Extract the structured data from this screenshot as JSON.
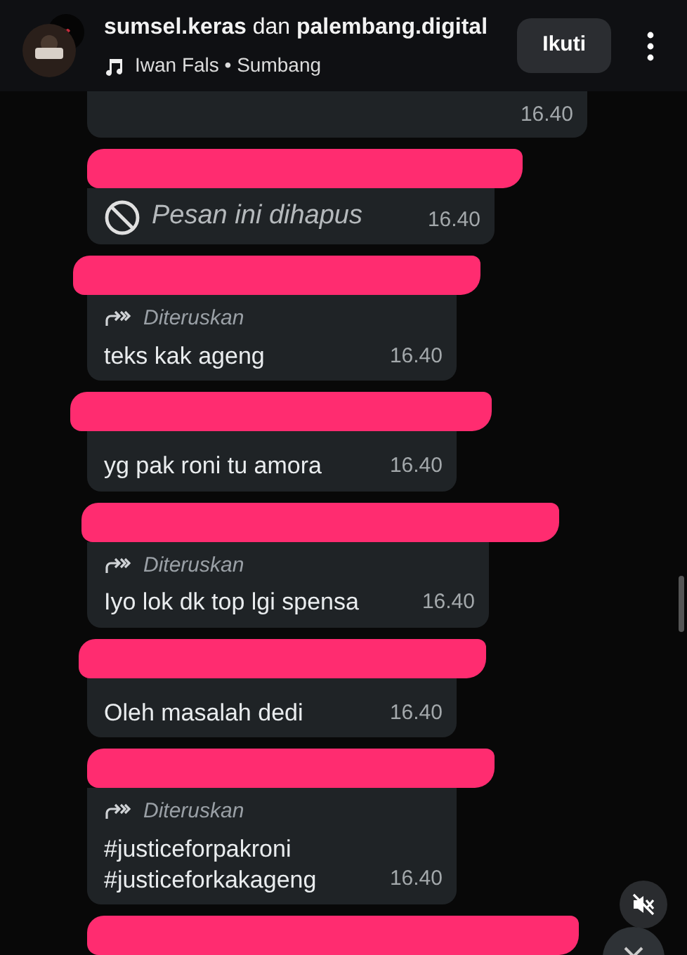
{
  "header": {
    "title": "**sumsel.keras** dan **palembang.digital**",
    "audio": "Iwan Fals • Sumbang",
    "follow_button": "Ikuti"
  },
  "messages": [
    {
      "kind": "partial",
      "time": "16.40"
    },
    {
      "kind": "deleted",
      "text": "Pesan ini dihapus",
      "time": "16.40"
    },
    {
      "kind": "forwarded",
      "label": "Diteruskan",
      "text": "teks kak ageng",
      "time": "16.40"
    },
    {
      "kind": "text",
      "text": "yg pak roni tu amora",
      "time": "16.40"
    },
    {
      "kind": "forwarded",
      "label": "Diteruskan",
      "text": "Iyo lok dk top lgi spensa",
      "time": "16.40"
    },
    {
      "kind": "text",
      "text": "Oleh masalah dedi",
      "time": "16.40"
    },
    {
      "kind": "forwarded",
      "label": "Diteruskan",
      "text": "#justiceforpakroni\n#justiceforkakageng",
      "time": "16.40"
    },
    {
      "kind": "stub"
    }
  ]
}
